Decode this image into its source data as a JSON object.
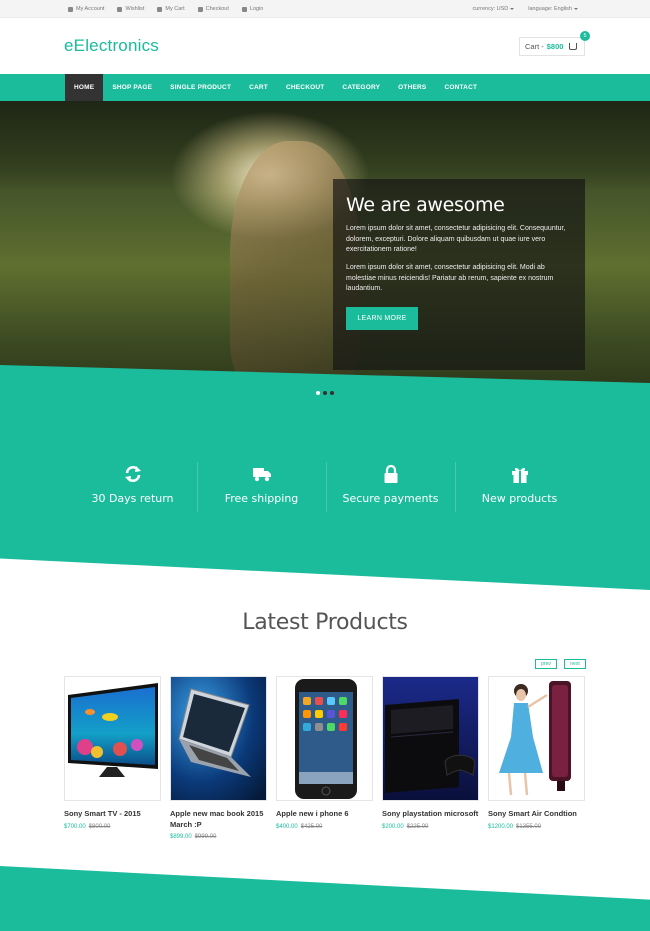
{
  "topbar": {
    "links": [
      "My Account",
      "Wishlist",
      "My Cart",
      "Checkout",
      "Login"
    ],
    "currency_label": "currency: USD",
    "language_label": "language: English"
  },
  "header": {
    "logo": "eElectronics",
    "cart_label": "Cart - ",
    "cart_amount": "$800",
    "cart_count": "5"
  },
  "nav": {
    "items": [
      "HOME",
      "SHOP PAGE",
      "SINGLE PRODUCT",
      "CART",
      "CHECKOUT",
      "CATEGORY",
      "OTHERS",
      "CONTACT"
    ],
    "active": "HOME"
  },
  "hero": {
    "title": "We are awesome",
    "para1": "Lorem ipsum dolor sit amet, consectetur adipisicing elit. Consequuntur, dolorem, excepturi. Dolore aliquam quibusdam ut quae iure vero exercitationem ratione!",
    "para2": "Lorem ipsum dolor sit amet, consectetur adipisicing elit. Modi ab molestiae minus reiciendis! Pariatur ab rerum, sapiente ex nostrum laudantium.",
    "button": "LEARN MORE",
    "slide_count": 3,
    "active_slide": 2
  },
  "features": [
    {
      "label": "30 Days return",
      "icon": "refresh-icon"
    },
    {
      "label": "Free shipping",
      "icon": "truck-icon"
    },
    {
      "label": "Secure payments",
      "icon": "lock-icon"
    },
    {
      "label": "New products",
      "icon": "gift-icon"
    }
  ],
  "latest": {
    "title": "Latest Products",
    "prev_label": "prev",
    "next_label": "next",
    "products": [
      {
        "name": "Sony Smart TV - 2015",
        "price": "$700.00",
        "old_price": "$800.00"
      },
      {
        "name": "Apple new mac book 2015 March :P",
        "price": "$899.00",
        "old_price": "$999.00"
      },
      {
        "name": "Apple new i phone 6",
        "price": "$400.00",
        "old_price": "$425.00"
      },
      {
        "name": "Sony playstation microsoft",
        "price": "$200.00",
        "old_price": "$225.00"
      },
      {
        "name": "Sony Smart Air Condtion",
        "price": "$1200.00",
        "old_price": "$1355.00"
      }
    ]
  },
  "colors": {
    "accent": "#1abc9c",
    "dark": "#333333"
  }
}
